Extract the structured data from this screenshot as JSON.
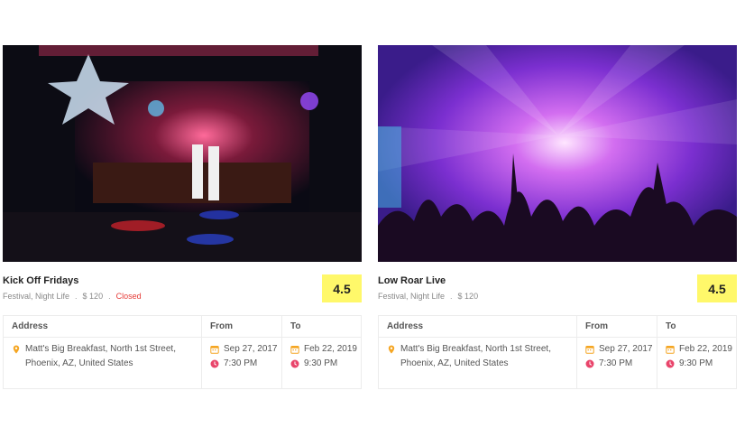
{
  "events": [
    {
      "title": "Kick Off Fridays",
      "category": "Festival, Night Life",
      "dot": ".",
      "price": "$ 120",
      "status": "Closed",
      "rating": "4.5",
      "table": {
        "address_header": "Address",
        "from_header": "From",
        "to_header": "To",
        "address": "Matt's Big Breakfast, North 1st Street, Phoenix, AZ, United States",
        "from_date": "Sep 27, 2017",
        "from_time": "7:30 PM",
        "to_date": "Feb 22, 2019",
        "to_time": "9:30 PM"
      }
    },
    {
      "title": "Low Roar Live",
      "category": "Festival, Night Life",
      "dot": ".",
      "price": "$ 120",
      "status": "",
      "rating": "4.5",
      "table": {
        "address_header": "Address",
        "from_header": "From",
        "to_header": "To",
        "address": "Matt's Big Breakfast, North 1st Street, Phoenix, AZ, United States",
        "from_date": "Sep 27, 2017",
        "from_time": "7:30 PM",
        "to_date": "Feb 22, 2019",
        "to_time": "9:30 PM"
      }
    }
  ],
  "colors": {
    "rating_bg": "#fff86a",
    "closed": "#e53935",
    "icon_pin": "#f5a623",
    "icon_calendar": "#f5a623",
    "icon_clock": "#e9456b"
  }
}
